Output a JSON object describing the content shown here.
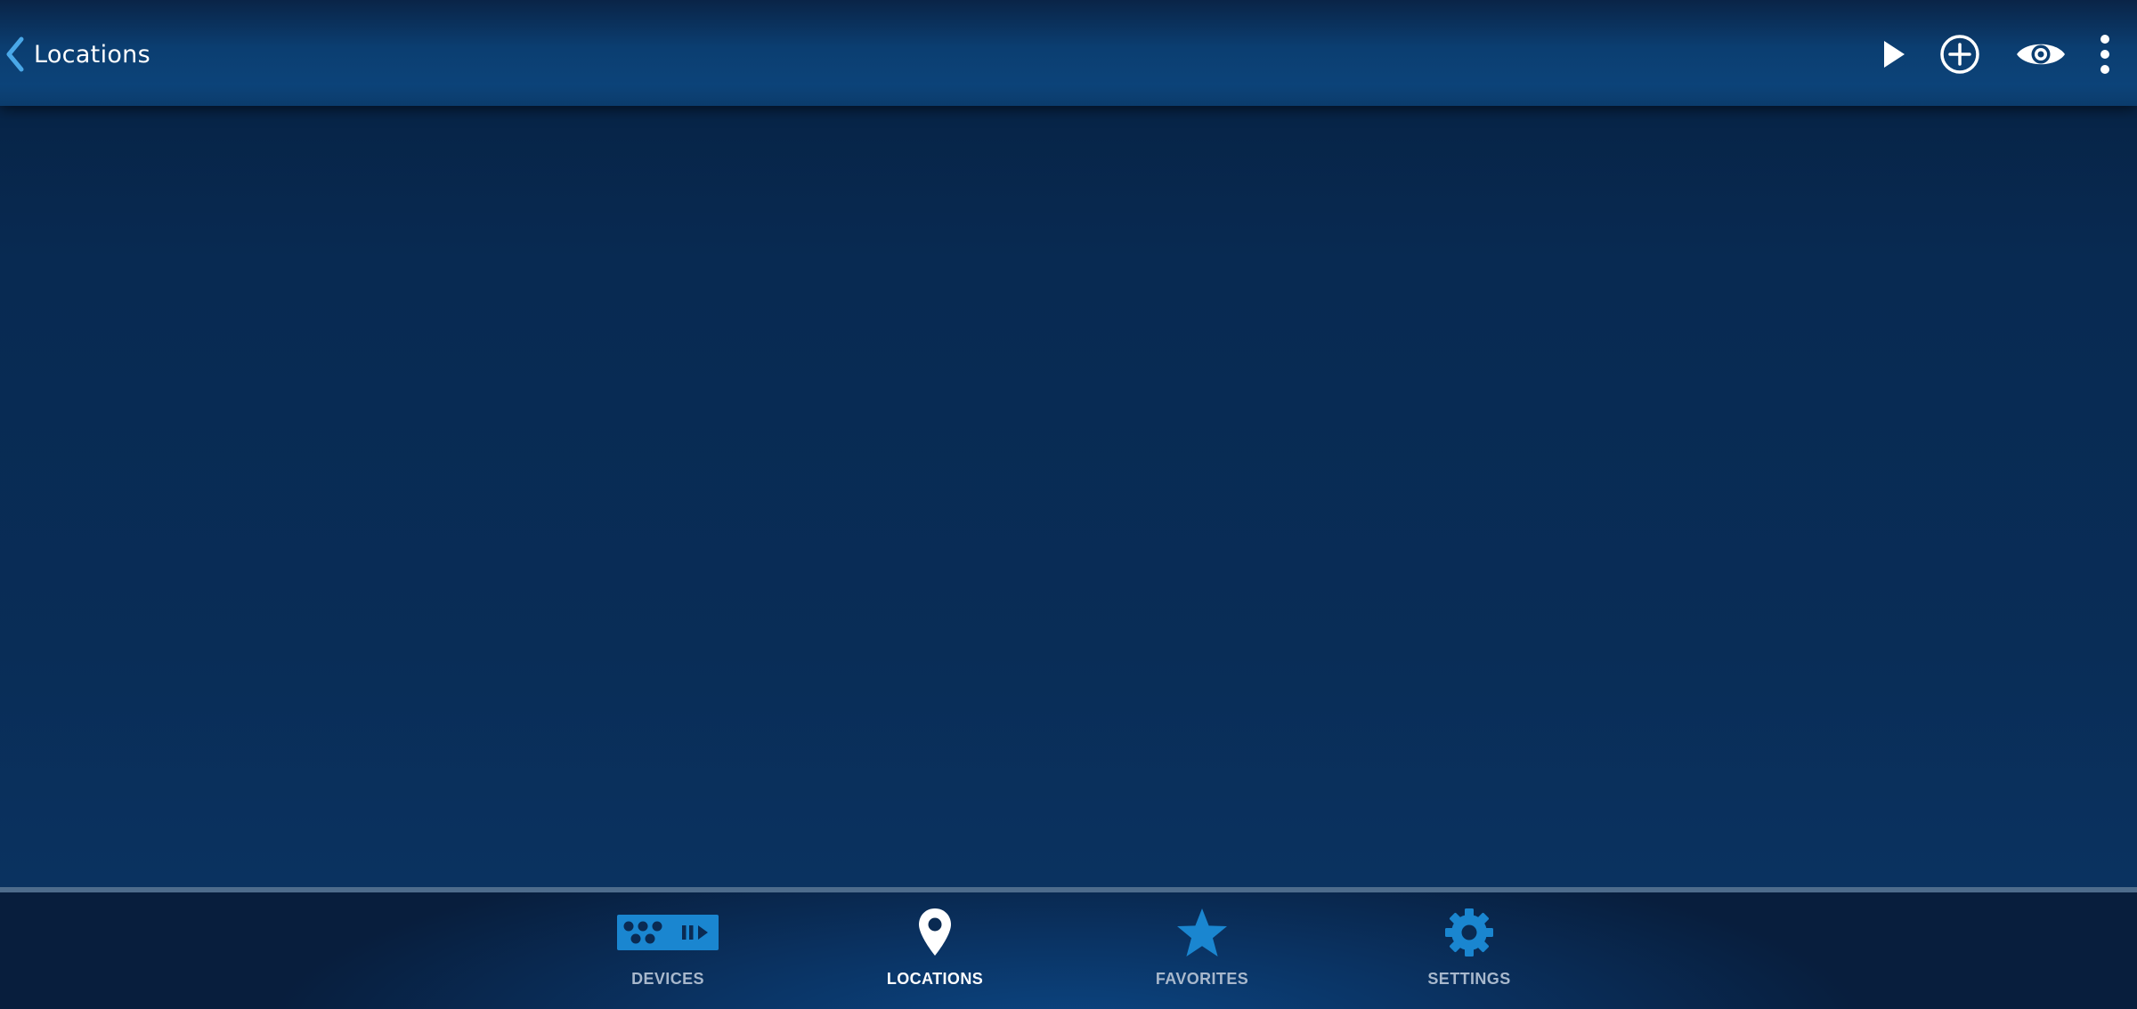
{
  "header": {
    "back_label": "Locations",
    "actions": [
      {
        "icon": "play-icon"
      },
      {
        "icon": "add-circle-icon"
      },
      {
        "icon": "eye-icon"
      },
      {
        "icon": "more-vertical-icon"
      }
    ]
  },
  "bottom_nav": {
    "tabs": [
      {
        "label": "DEVICES",
        "icon": "devices-icon",
        "active": false
      },
      {
        "label": "LOCATIONS",
        "icon": "location-pin-icon",
        "active": true
      },
      {
        "label": "FAVORITES",
        "icon": "star-icon",
        "active": false
      },
      {
        "label": "SETTINGS",
        "icon": "gear-icon",
        "active": false
      }
    ]
  },
  "colors": {
    "accent": "#1a86d0",
    "back_chevron": "#4aa8e8",
    "active_label": "#ffffff",
    "inactive_label": "#a8b8cc",
    "header_bg": "#0c4379",
    "content_bg": "#082a52",
    "nav_divider": "#4e6c8c"
  }
}
